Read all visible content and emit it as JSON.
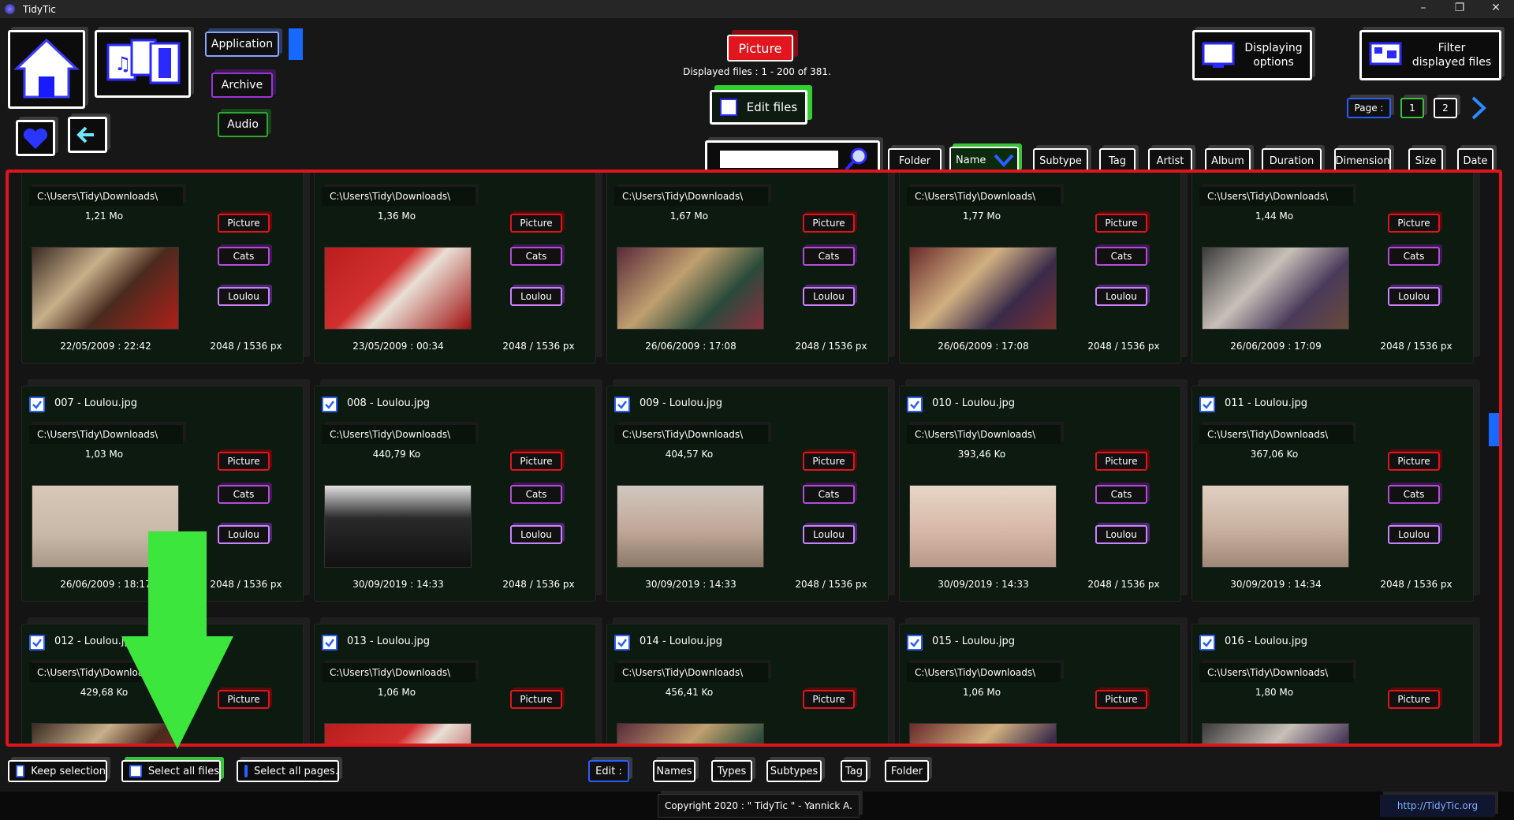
{
  "window": {
    "title": "TidyTic",
    "min": "–",
    "max": "❐",
    "close": "✕"
  },
  "left_buttons": {
    "application": "Application",
    "archive": "Archive",
    "audio": "Audio"
  },
  "header": {
    "picture_label": "Picture",
    "displayed": "Displayed files : 1 - 200 of 381.",
    "edit_files": "Edit files"
  },
  "right_buttons": {
    "display_options_1": "Displaying",
    "display_options_2": "options",
    "filter_1": "Filter",
    "filter_2": "displayed files"
  },
  "pager": {
    "label": "Page :",
    "pages": [
      "1",
      "2"
    ]
  },
  "search": {
    "placeholder": ""
  },
  "sort": [
    "Folder",
    "Name",
    "Subtype",
    "Tag",
    "Artist",
    "Album",
    "Duration",
    "Dimension",
    "Size",
    "Date"
  ],
  "sort_active": "Name",
  "files": [
    {
      "name": "",
      "path": "C:\\Users\\Tidy\\Downloads\\",
      "size": "1,21 Mo",
      "type": "Picture",
      "tag1": "Cats",
      "tag2": "Loulou",
      "date": "22/05/2009 : 22:42",
      "dim": "2048 / 1536 px"
    },
    {
      "name": "",
      "path": "C:\\Users\\Tidy\\Downloads\\",
      "size": "1,36 Mo",
      "type": "Picture",
      "tag1": "Cats",
      "tag2": "Loulou",
      "date": "23/05/2009 : 00:34",
      "dim": "2048 / 1536 px"
    },
    {
      "name": "",
      "path": "C:\\Users\\Tidy\\Downloads\\",
      "size": "1,67 Mo",
      "type": "Picture",
      "tag1": "Cats",
      "tag2": "Loulou",
      "date": "26/06/2009 : 17:08",
      "dim": "2048 / 1536 px"
    },
    {
      "name": "",
      "path": "C:\\Users\\Tidy\\Downloads\\",
      "size": "1,77 Mo",
      "type": "Picture",
      "tag1": "Cats",
      "tag2": "Loulou",
      "date": "26/06/2009 : 17:08",
      "dim": "2048 / 1536 px"
    },
    {
      "name": "",
      "path": "C:\\Users\\Tidy\\Downloads\\",
      "size": "1,44 Mo",
      "type": "Picture",
      "tag1": "Cats",
      "tag2": "Loulou",
      "date": "26/06/2009 : 17:09",
      "dim": "2048 / 1536 px"
    },
    {
      "name": "007 - Loulou.jpg",
      "path": "C:\\Users\\Tidy\\Downloads\\",
      "size": "1,03 Mo",
      "type": "Picture",
      "tag1": "Cats",
      "tag2": "Loulou",
      "date": "26/06/2009 : 18:17",
      "dim": "2048 / 1536 px"
    },
    {
      "name": "008 - Loulou.jpg",
      "path": "C:\\Users\\Tidy\\Downloads\\",
      "size": "440,79 Ko",
      "type": "Picture",
      "tag1": "Cats",
      "tag2": "Loulou",
      "date": "30/09/2019 : 14:33",
      "dim": "2048 / 1536 px"
    },
    {
      "name": "009 - Loulou.jpg",
      "path": "C:\\Users\\Tidy\\Downloads\\",
      "size": "404,57 Ko",
      "type": "Picture",
      "tag1": "Cats",
      "tag2": "Loulou",
      "date": "30/09/2019 : 14:33",
      "dim": "2048 / 1536 px"
    },
    {
      "name": "010 - Loulou.jpg",
      "path": "C:\\Users\\Tidy\\Downloads\\",
      "size": "393,46 Ko",
      "type": "Picture",
      "tag1": "Cats",
      "tag2": "Loulou",
      "date": "30/09/2019 : 14:33",
      "dim": "2048 / 1536 px"
    },
    {
      "name": "011 - Loulou.jpg",
      "path": "C:\\Users\\Tidy\\Downloads\\",
      "size": "367,06 Ko",
      "type": "Picture",
      "tag1": "Cats",
      "tag2": "Loulou",
      "date": "30/09/2019 : 14:34",
      "dim": "2048 / 1536 px"
    },
    {
      "name": "012 - Loulou.jpg",
      "path": "C:\\Users\\Tidy\\Downloads\\",
      "size": "429,68 Ko",
      "type": "Picture",
      "tag1": "",
      "tag2": "",
      "date": "",
      "dim": ""
    },
    {
      "name": "013 - Loulou.jpg",
      "path": "C:\\Users\\Tidy\\Downloads\\",
      "size": "1,06 Mo",
      "type": "Picture",
      "tag1": "",
      "tag2": "",
      "date": "",
      "dim": ""
    },
    {
      "name": "014 - Loulou.jpg",
      "path": "C:\\Users\\Tidy\\Downloads\\",
      "size": "456,41 Ko",
      "type": "Picture",
      "tag1": "",
      "tag2": "",
      "date": "",
      "dim": ""
    },
    {
      "name": "015 - Loulou.jpg",
      "path": "C:\\Users\\Tidy\\Downloads\\",
      "size": "1,06 Mo",
      "type": "Picture",
      "tag1": "",
      "tag2": "",
      "date": "",
      "dim": ""
    },
    {
      "name": "016 - Loulou.jpg",
      "path": "C:\\Users\\Tidy\\Downloads\\",
      "size": "1,80 Mo",
      "type": "Picture",
      "tag1": "",
      "tag2": "",
      "date": "",
      "dim": ""
    }
  ],
  "bottom": {
    "keep": "Keep selection",
    "select_all": "Select all files",
    "select_pages": "Select all pages.",
    "edit": "Edit :",
    "names": "Names",
    "types": "Types",
    "subtypes": "Subtypes",
    "tag": "Tag",
    "folder": "Folder"
  },
  "footer": {
    "copyright": "Copyright 2020 : \" TidyTic \" - Yannick A.",
    "url": "http://TidyTic.org"
  },
  "colors": {
    "accent_red": "#e0141c",
    "accent_green": "#2fd02f",
    "accent_blue": "#1769ff"
  }
}
